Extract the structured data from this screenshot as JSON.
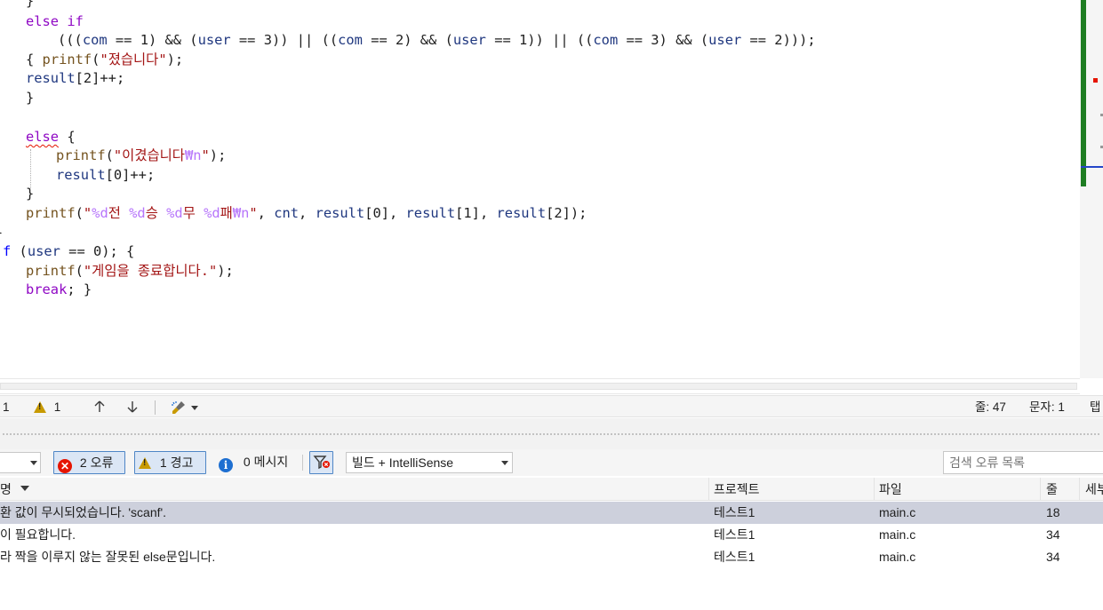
{
  "editor": {
    "lines": [
      "}",
      "else if",
      "(((com == 1) && (user == 3)) || ((com == 2) && (user == 1)) || ((com == 3) && (user == 2)));",
      "{ printf(\"졌습니다\");",
      "result[2]++;",
      "}",
      "else {",
      "printf(\"이겼습니다₩n\");",
      "result[0]++;",
      "}",
      "printf(\"%d전 %d승 %d무 %d패₩n\", cnt, result[0], result[1], result[2]);",
      "}",
      "f (user == 0); {",
      "printf(\"게임을 종료합니다.\");",
      "break; }"
    ]
  },
  "status_bar": {
    "error_count": "1",
    "warning_count": "1",
    "line_label": "줄: 47",
    "char_label": "문자: 1",
    "tab_label": "탭"
  },
  "error_list": {
    "toolbar": {
      "errors_label": "2 오류",
      "warnings_label": "1 경고",
      "messages_label": "0 메시지",
      "build_filter": "빌드 + IntelliSense",
      "search_placeholder": "검색 오류 목록"
    },
    "columns": {
      "description": "명",
      "project": "프로젝트",
      "file": "파일",
      "line": "줄",
      "extra": "세부"
    },
    "rows": [
      {
        "description": "환 값이 무시되었습니다. 'scanf'.",
        "project": "테스트1",
        "file": "main.c",
        "line": "18"
      },
      {
        "description": "이 필요합니다.",
        "project": "테스트1",
        "file": "main.c",
        "line": "34"
      },
      {
        "description": "라 짝을 이루지 않는 잘못된 else문입니다.",
        "project": "테스트1",
        "file": "main.c",
        "line": "34"
      }
    ]
  },
  "colors": {
    "keyword": "#8f08c4",
    "identifier": "#1f377f",
    "function": "#74531f",
    "string": "#a31515",
    "escape": "#b776fb",
    "change_bar": "#1e7d22",
    "error": "#e51400",
    "selected_row": "#cdd0dc"
  }
}
